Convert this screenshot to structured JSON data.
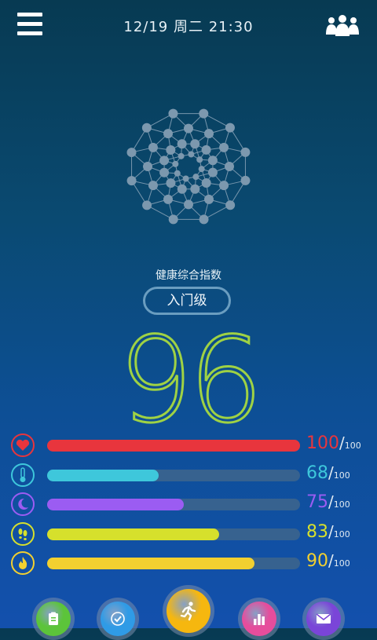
{
  "header": {
    "datetime": "12/19 周二 21:30",
    "menu_icon": "hamburger-menu-icon",
    "people_icon": "group-people-icon"
  },
  "health": {
    "label": "健康综合指数",
    "level": "入门级",
    "score": "96"
  },
  "metrics": [
    {
      "name": "heart",
      "icon": "heart-icon",
      "value": "100",
      "slash": "/",
      "max": "100",
      "fraction": 1.0,
      "color": "#e8353d"
    },
    {
      "name": "temperature",
      "icon": "thermometer-icon",
      "value": "68",
      "slash": "/",
      "max": "100",
      "fraction": 0.44,
      "color": "#3ec7db"
    },
    {
      "name": "sleep",
      "icon": "moon-icon",
      "value": "75",
      "slash": "/",
      "max": "100",
      "fraction": 0.54,
      "color": "#9b5cf2"
    },
    {
      "name": "steps",
      "icon": "footprints-icon",
      "value": "83",
      "slash": "/",
      "max": "100",
      "fraction": 0.68,
      "color": "#d6e02c"
    },
    {
      "name": "calories",
      "icon": "flame-icon",
      "value": "90",
      "slash": "/",
      "max": "100",
      "fraction": 0.82,
      "color": "#f2d030"
    }
  ],
  "dock": [
    {
      "name": "report",
      "icon": "clipboard-icon",
      "color": "#5cc43a"
    },
    {
      "name": "check",
      "icon": "checkmark-icon",
      "color": "#2f9be6"
    },
    {
      "name": "exercise",
      "icon": "running-person-icon",
      "color": "#f6b70f"
    },
    {
      "name": "stats",
      "icon": "bar-chart-icon",
      "color": "#e64d9c"
    },
    {
      "name": "messages",
      "icon": "envelope-icon",
      "color": "#7a45d8"
    }
  ]
}
